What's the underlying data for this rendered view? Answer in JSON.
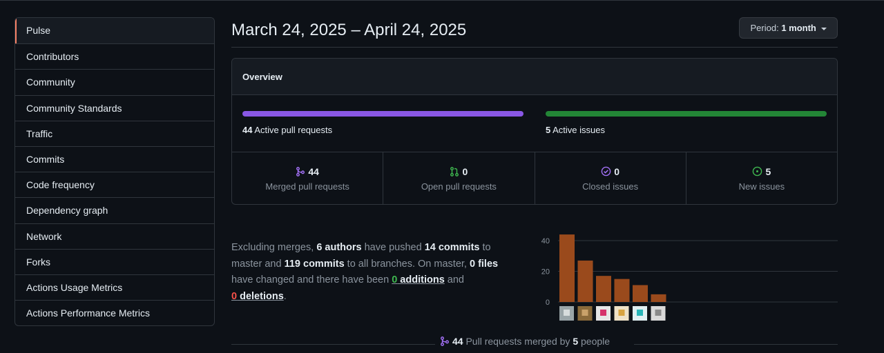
{
  "sidebar": {
    "items": [
      {
        "label": "Pulse",
        "selected": true
      },
      {
        "label": "Contributors"
      },
      {
        "label": "Community"
      },
      {
        "label": "Community Standards"
      },
      {
        "label": "Traffic"
      },
      {
        "label": "Commits"
      },
      {
        "label": "Code frequency"
      },
      {
        "label": "Dependency graph"
      },
      {
        "label": "Network"
      },
      {
        "label": "Forks"
      },
      {
        "label": "Actions Usage Metrics"
      },
      {
        "label": "Actions Performance Metrics"
      }
    ]
  },
  "header": {
    "date_range": "March 24, 2025 – April 24, 2025",
    "period_prefix": "Period:",
    "period_value": "1 month"
  },
  "overview": {
    "title": "Overview",
    "active_prs_count": "44",
    "active_prs_label": "Active pull requests",
    "active_issues_count": "5",
    "active_issues_label": "Active issues",
    "stats": [
      {
        "icon": "git-merge-icon",
        "value": "44",
        "label": "Merged pull requests",
        "color": "#a371f7"
      },
      {
        "icon": "git-pull-request-icon",
        "value": "0",
        "label": "Open pull requests",
        "color": "#3fb950"
      },
      {
        "icon": "issue-closed-icon",
        "value": "0",
        "label": "Closed issues",
        "color": "#a371f7"
      },
      {
        "icon": "issue-opened-icon",
        "value": "5",
        "label": "New issues",
        "color": "#3fb950"
      }
    ]
  },
  "summary": {
    "t1": "Excluding merges, ",
    "authors": "6 authors",
    "t2": " have pushed ",
    "commits": "14 commits",
    "t3": " to master and ",
    "all_commits": "119 commits",
    "t4": " to all branches. On master, ",
    "files": "0 files",
    "t5": " have changed and there have been ",
    "additions_n": "0",
    "additions_w": " additions",
    "t6": " and",
    "deletions_n": "0",
    "deletions_w": " deletions",
    "t7": "."
  },
  "chart_data": {
    "type": "bar",
    "categories": [
      "author-1",
      "author-2",
      "author-3",
      "author-4",
      "author-5",
      "author-6"
    ],
    "values": [
      44,
      27,
      17,
      15,
      11,
      5
    ],
    "yticks": [
      "0",
      "20",
      "40"
    ],
    "ylim": [
      0,
      40
    ],
    "bar_color": "#9a4a1c",
    "grid": true
  },
  "footer": {
    "count": "44",
    "text": " Pull requests merged by ",
    "people_count": "5",
    "people_word": " people"
  },
  "colors": {
    "accent_selected": "#f78166",
    "pr_bar": "#8957e5",
    "issue_bar": "#238636"
  }
}
